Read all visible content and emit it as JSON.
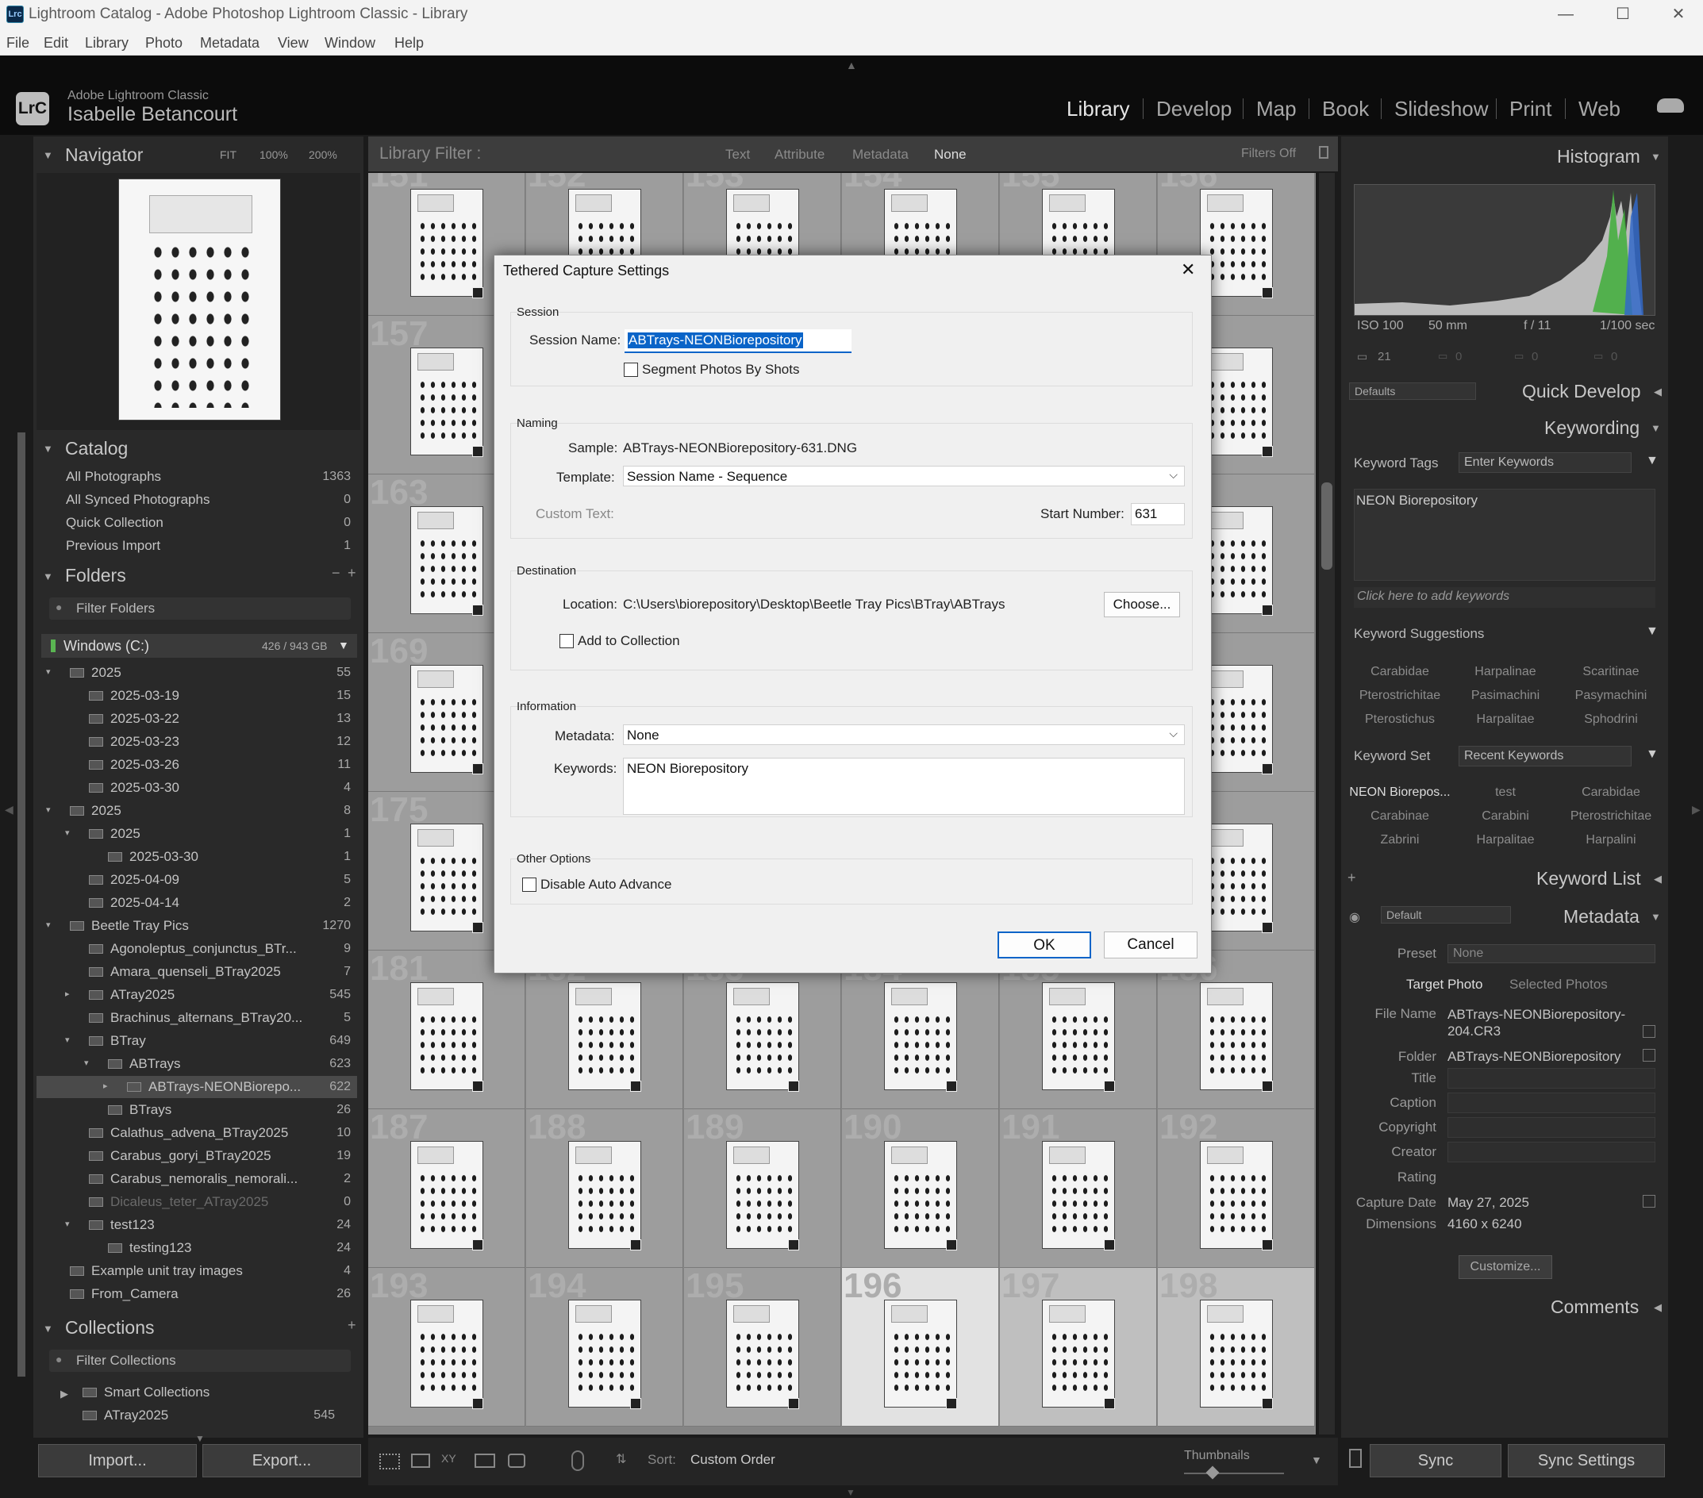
{
  "window": {
    "title": "Lightroom Catalog - Adobe Photoshop Lightroom Classic - Library",
    "icon": "Lrc",
    "min": "—",
    "max": "☐",
    "close": "✕"
  },
  "menu": [
    "File",
    "Edit",
    "Library",
    "Photo",
    "Metadata",
    "View",
    "Window",
    "Help"
  ],
  "identity": {
    "product": "Adobe Lightroom Classic",
    "user": "Isabelle Betancourt",
    "logo": "LrC"
  },
  "modules": [
    "Library",
    "Develop",
    "Map",
    "Book",
    "Slideshow",
    "Print",
    "Web"
  ],
  "navigator": {
    "title": "Navigator",
    "fit": "FIT",
    "z1": "100%",
    "z2": "200%"
  },
  "catalog": {
    "title": "Catalog",
    "items": [
      {
        "label": "All Photographs",
        "count": "1363"
      },
      {
        "label": "All Synced Photographs",
        "count": "0"
      },
      {
        "label": "Quick Collection",
        "count": "0"
      },
      {
        "label": "Previous Import",
        "count": "1"
      }
    ]
  },
  "folders": {
    "title": "Folders",
    "filter": "Filter Folders",
    "volume": "Windows (C:)",
    "volume_size": "426 / 943 GB",
    "items": [
      {
        "label": "2025",
        "count": "55",
        "lvl": 0,
        "exp": "▾"
      },
      {
        "label": "2025-03-19",
        "count": "15",
        "lvl": 1,
        "exp": ""
      },
      {
        "label": "2025-03-22",
        "count": "13",
        "lvl": 1,
        "exp": ""
      },
      {
        "label": "2025-03-23",
        "count": "12",
        "lvl": 1,
        "exp": ""
      },
      {
        "label": "2025-03-26",
        "count": "11",
        "lvl": 1,
        "exp": ""
      },
      {
        "label": "2025-03-30",
        "count": "4",
        "lvl": 1,
        "exp": ""
      },
      {
        "label": "2025",
        "count": "8",
        "lvl": 0,
        "exp": "▾"
      },
      {
        "label": "2025",
        "count": "1",
        "lvl": 1,
        "exp": "▾"
      },
      {
        "label": "2025-03-30",
        "count": "1",
        "lvl": 2,
        "exp": ""
      },
      {
        "label": "2025-04-09",
        "count": "5",
        "lvl": 1,
        "exp": ""
      },
      {
        "label": "2025-04-14",
        "count": "2",
        "lvl": 1,
        "exp": ""
      },
      {
        "label": "Beetle Tray Pics",
        "count": "1270",
        "lvl": 0,
        "exp": "▾"
      },
      {
        "label": "Agonoleptus_conjunctus_BTr...",
        "count": "9",
        "lvl": 1,
        "exp": ""
      },
      {
        "label": "Amara_quenseli_BTray2025",
        "count": "7",
        "lvl": 1,
        "exp": ""
      },
      {
        "label": "ATray2025",
        "count": "545",
        "lvl": 1,
        "exp": "▸"
      },
      {
        "label": "Brachinus_alternans_BTray20...",
        "count": "5",
        "lvl": 1,
        "exp": ""
      },
      {
        "label": "BTray",
        "count": "649",
        "lvl": 1,
        "exp": "▾"
      },
      {
        "label": "ABTrays",
        "count": "623",
        "lvl": 2,
        "exp": "▾"
      },
      {
        "label": "ABTrays-NEONBiorepo...",
        "count": "622",
        "lvl": 3,
        "exp": "▸"
      },
      {
        "label": "BTrays",
        "count": "26",
        "lvl": 2,
        "exp": ""
      },
      {
        "label": "Calathus_advena_BTray2025",
        "count": "10",
        "lvl": 1,
        "exp": ""
      },
      {
        "label": "Carabus_goryi_BTray2025",
        "count": "19",
        "lvl": 1,
        "exp": ""
      },
      {
        "label": "Carabus_nemoralis_nemorali...",
        "count": "2",
        "lvl": 1,
        "exp": ""
      },
      {
        "label": "Dicaleus_teter_ATray2025",
        "count": "0",
        "lvl": 1,
        "exp": ""
      },
      {
        "label": "test123",
        "count": "24",
        "lvl": 1,
        "exp": "▾"
      },
      {
        "label": "testing123",
        "count": "24",
        "lvl": 2,
        "exp": ""
      },
      {
        "label": "Example unit tray images",
        "count": "4",
        "lvl": 0,
        "exp": ""
      },
      {
        "label": "From_Camera",
        "count": "26",
        "lvl": 0,
        "exp": ""
      }
    ]
  },
  "collections": {
    "title": "Collections",
    "filter": "Filter Collections",
    "items": [
      {
        "label": "Smart Collections",
        "count": ""
      },
      {
        "label": "ATray2025",
        "count": "545"
      }
    ]
  },
  "left_buttons": {
    "import": "Import...",
    "export": "Export..."
  },
  "filterbar": {
    "title": "Library Filter :",
    "opts": [
      "Text",
      "Attribute",
      "Metadata",
      "None"
    ],
    "state": "Filters Off"
  },
  "grid_numbers": [
    "151",
    "152",
    "153",
    "154",
    "155",
    "156",
    "157",
    "",
    "",
    "",
    "",
    "",
    "163",
    "",
    "",
    "",
    "",
    "",
    "169",
    "",
    "",
    "",
    "",
    "",
    "175",
    "",
    "",
    "",
    "",
    "",
    "181",
    "182",
    "183",
    "184",
    "185",
    "186",
    "187",
    "188",
    "189",
    "190",
    "191",
    "192",
    "193",
    "194",
    "195",
    "196",
    "197",
    "198"
  ],
  "toolbar": {
    "sort_label": "Sort:",
    "sort_value": "Custom Order",
    "thumbs": "Thumbnails"
  },
  "dialog": {
    "title": "Tethered Capture Settings",
    "session_grp": "Session",
    "session_name_label": "Session Name:",
    "session_name": "ABTrays-NEONBiorepository",
    "segment": "Segment Photos By Shots",
    "naming_grp": "Naming",
    "sample_label": "Sample:",
    "sample": "ABTrays-NEONBiorepository-631.DNG",
    "template_label": "Template:",
    "template": "Session Name - Sequence",
    "custom_label": "Custom Text:",
    "start_label": "Start Number:",
    "start": "631",
    "dest_grp": "Destination",
    "location_label": "Location:",
    "location": "C:\\Users\\biorepository\\Desktop\\Beetle Tray Pics\\BTray\\ABTrays",
    "choose": "Choose...",
    "add_collection": "Add to Collection",
    "info_grp": "Information",
    "metadata_label": "Metadata:",
    "metadata": "None",
    "keywords_label": "Keywords:",
    "keywords": "NEON Biorepository",
    "other_grp": "Other Options",
    "auto_advance": "Disable Auto Advance",
    "ok": "OK",
    "cancel": "Cancel",
    "close": "✕"
  },
  "histogram": {
    "title": "Histogram",
    "iso": "ISO 100",
    "focal": "50 mm",
    "aperture": "f / 11",
    "shutter": "1/100 sec",
    "count": "21",
    "z1": "0",
    "z2": "0",
    "z3": "0"
  },
  "quick_develop": {
    "title": "Quick Develop",
    "preset": "Defaults"
  },
  "keywording": {
    "title": "Keywording",
    "tags_label": "Keyword Tags",
    "tags_value": "Enter Keywords",
    "tag_text": "NEON Biorepository",
    "add_hint": "Click here to add keywords",
    "suggest_title": "Keyword Suggestions",
    "suggest": [
      "Carabidae",
      "Harpalinae",
      "Scaritinae",
      "Pterostrichitae",
      "Pasimachini",
      "Pasymachini",
      "Pterostichus",
      "Harpalitae",
      "Sphodrini"
    ],
    "set_label": "Keyword Set",
    "set_value": "Recent Keywords",
    "set": [
      "NEON Biorepos...",
      "test",
      "Carabidae",
      "Carabinae",
      "Carabini",
      "Pterostrichitae",
      "Zabrini",
      "Harpalitae",
      "Harpalini"
    ]
  },
  "keyword_list": {
    "title": "Keyword List"
  },
  "metadata": {
    "title": "Metadata",
    "preset_sel": "Default",
    "preset_label": "Preset",
    "preset_value": "None",
    "tab1": "Target Photo",
    "tab2": "Selected Photos",
    "file_label": "File Name",
    "file_value": "ABTrays-NEONBiorepository-204.CR3",
    "folder_label": "Folder",
    "folder_value": "ABTrays-NEONBiorepository",
    "title_label": "Title",
    "caption_label": "Caption",
    "copyright_label": "Copyright",
    "creator_label": "Creator",
    "rating_label": "Rating",
    "date_label": "Capture Date",
    "date_value": "May 27, 2025",
    "dim_label": "Dimensions",
    "dim_value": "4160 x 6240",
    "customize": "Customize..."
  },
  "comments": {
    "title": "Comments"
  },
  "sync": {
    "sync": "Sync",
    "settings": "Sync Settings"
  },
  "colors": {
    "accent": "#0a64c8",
    "panel": "#292929",
    "grid": "#9d9d9d"
  }
}
